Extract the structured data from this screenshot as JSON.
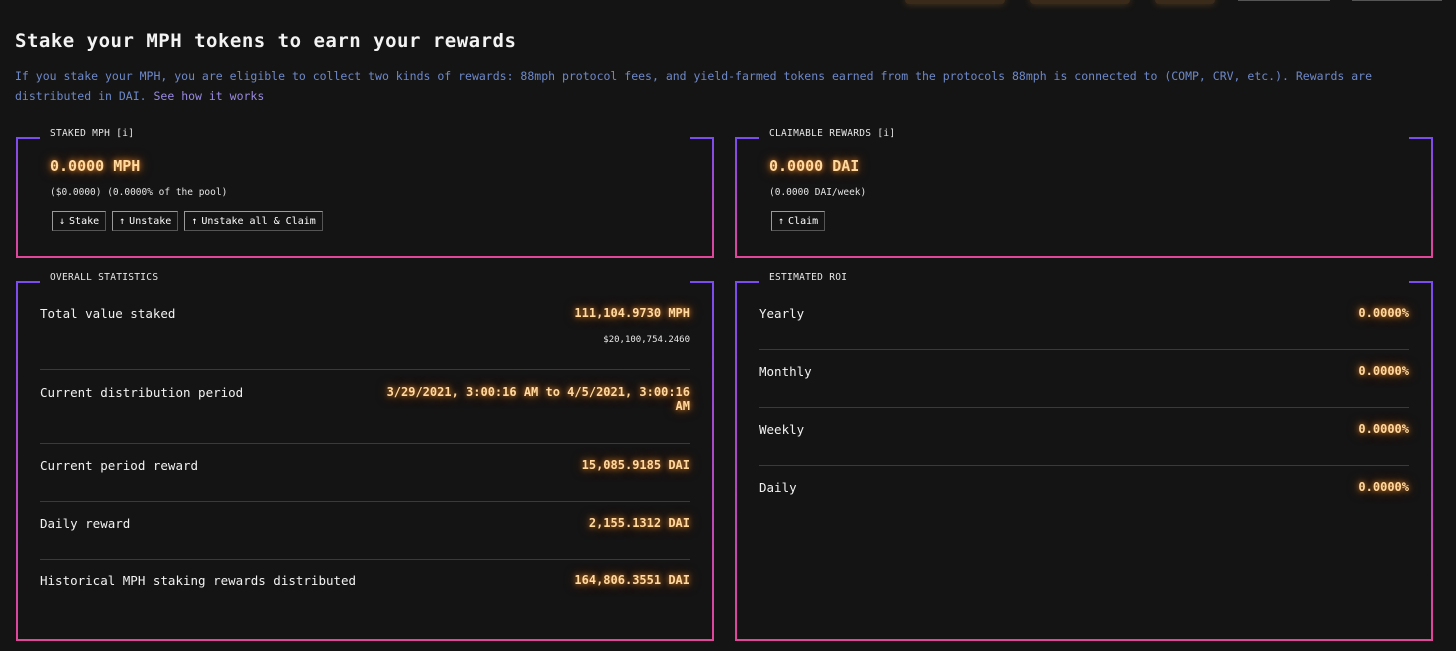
{
  "page": {
    "title": "Stake your MPH tokens to earn your rewards",
    "description": "If you stake your MPH, you are eligible to collect two kinds of rewards: 88mph protocol fees, and yield-farmed tokens earned from the protocols 88mph is connected to (COMP, CRV, etc.). Rewards are distributed in DAI.",
    "link_text": "See how it works"
  },
  "staked": {
    "label": "STAKED MPH [i]",
    "amount": "0.0000 MPH",
    "detail": "($0.0000) (0.0000% of the pool)",
    "buttons": [
      {
        "icon": "↓",
        "label": "Stake"
      },
      {
        "icon": "↑",
        "label": "Unstake"
      },
      {
        "icon": "↑",
        "label": "Unstake all & Claim"
      }
    ]
  },
  "claimable": {
    "label": "CLAIMABLE REWARDS [i]",
    "amount": "0.0000 DAI",
    "detail": "(0.0000 DAI/week)",
    "buttons": [
      {
        "icon": "↑",
        "label": "Claim"
      }
    ]
  },
  "overall": {
    "label": "OVERALL STATISTICS",
    "rows": [
      {
        "key": "Total value staked",
        "value": "111,104.9730 MPH",
        "sub": "$20,100,754.2460"
      },
      {
        "key": "Current distribution period",
        "value": "3/29/2021, 3:00:16 AM to 4/5/2021, 3:00:16 AM"
      },
      {
        "key": "Current period reward",
        "value": "15,085.9185 DAI"
      },
      {
        "key": "Daily reward",
        "value": "2,155.1312 DAI"
      },
      {
        "key": "Historical MPH staking rewards distributed",
        "value": "164,806.3551 DAI"
      }
    ]
  },
  "roi": {
    "label": "ESTIMATED ROI",
    "rows": [
      {
        "key": "Yearly",
        "value": "0.0000%"
      },
      {
        "key": "Monthly",
        "value": "0.0000%"
      },
      {
        "key": "Weekly",
        "value": "0.0000%"
      },
      {
        "key": "Daily",
        "value": "0.0000%"
      }
    ]
  },
  "colors": {
    "background": "#141414",
    "accent_purple": "#7b4cf0",
    "accent_pink": "#e0469a",
    "glow_orange": "#ffd9a0",
    "desc_blue": "#6e88c8"
  }
}
